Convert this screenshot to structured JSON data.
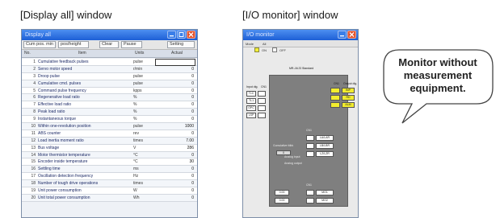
{
  "captions": {
    "display_all": "[Display all] window",
    "io_monitor": "[I/O monitor] window"
  },
  "display_all": {
    "title": "Display all",
    "toolbar": [
      "Cum pos. min",
      "pos/height",
      "Clear",
      "Pause",
      "Setting"
    ],
    "headers": {
      "no": "No.",
      "name": "Item",
      "unit": "Units",
      "value": "Actual"
    },
    "rows": [
      {
        "no": "1",
        "name": "Cumulative feedback pulses",
        "unit": "pulse",
        "value": "",
        "selected": true
      },
      {
        "no": "2",
        "name": "Servo motor speed",
        "unit": "r/min",
        "value": "0"
      },
      {
        "no": "3",
        "name": "Droop pulse",
        "unit": "pulse",
        "value": "0"
      },
      {
        "no": "4",
        "name": "Cumulative cmd. pulses",
        "unit": "pulse",
        "value": "0"
      },
      {
        "no": "5",
        "name": "Command pulse frequency",
        "unit": "kpps",
        "value": "0"
      },
      {
        "no": "6",
        "name": "Regenerative load ratio",
        "unit": "%",
        "value": "0"
      },
      {
        "no": "7",
        "name": "Effective load ratio",
        "unit": "%",
        "value": "0"
      },
      {
        "no": "8",
        "name": "Peak load ratio",
        "unit": "%",
        "value": "0"
      },
      {
        "no": "9",
        "name": "Instantaneous torque",
        "unit": "%",
        "value": "0"
      },
      {
        "no": "10",
        "name": "Within one-revolution position",
        "unit": "pulse",
        "value": "1000"
      },
      {
        "no": "11",
        "name": "ABS counter",
        "unit": "rev",
        "value": "0"
      },
      {
        "no": "12",
        "name": "Load inertia moment ratio",
        "unit": "times",
        "value": "7.00"
      },
      {
        "no": "13",
        "name": "Bus voltage",
        "unit": "V",
        "value": "286"
      },
      {
        "no": "14",
        "name": "Motor thermistor temperature",
        "unit": "°C",
        "value": "0"
      },
      {
        "no": "15",
        "name": "Encoder inside temperature",
        "unit": "°C",
        "value": "30"
      },
      {
        "no": "16",
        "name": "Settling time",
        "unit": "ms",
        "value": "0"
      },
      {
        "no": "17",
        "name": "Oscillation detection frequency",
        "unit": "Hz",
        "value": "0"
      },
      {
        "no": "18",
        "name": "Number of tough drive operations",
        "unit": "times",
        "value": "0"
      },
      {
        "no": "19",
        "name": "Unit power consumption",
        "unit": "W",
        "value": "0"
      },
      {
        "no": "20",
        "name": "Unit total power consumption",
        "unit": "Wh",
        "value": "0"
      }
    ]
  },
  "io_monitor": {
    "title": "I/O monitor",
    "toolbar": {
      "mode": "Mode",
      "all": "All"
    },
    "legend": {
      "on": "ON",
      "off": "OFF"
    },
    "diagram_title": "MR-J4/J3 Standard",
    "left_block": {
      "header": "CN1",
      "labels": [
        "Input dig.",
        "TLC",
        "TL1",
        "OPC",
        "LSP"
      ]
    },
    "right_block": {
      "header": "CN1",
      "labels": [
        "Output dig.",
        "INP",
        "RD",
        "ALM"
      ]
    },
    "mid_block": {
      "header": "CN1",
      "labels": [
        "Cumulative fdbk",
        "Analog input",
        "Analog output"
      ],
      "cells": [
        "0",
        "0",
        "LA/LAR",
        "LB/LBR",
        "LZ/LZR"
      ]
    },
    "bottom_block": {
      "header": "CN1",
      "cells": [
        "0.00",
        "0.00",
        "MO1",
        "MO2"
      ]
    }
  },
  "callout": {
    "line1": "Monitor without",
    "line2": "measurement",
    "line3": "equipment."
  },
  "colors": {
    "titlebar": "#1d5fd6",
    "close_button": "#e2532e",
    "io_on": "#f2ec2e",
    "io_panel": "#7f7f7f"
  }
}
